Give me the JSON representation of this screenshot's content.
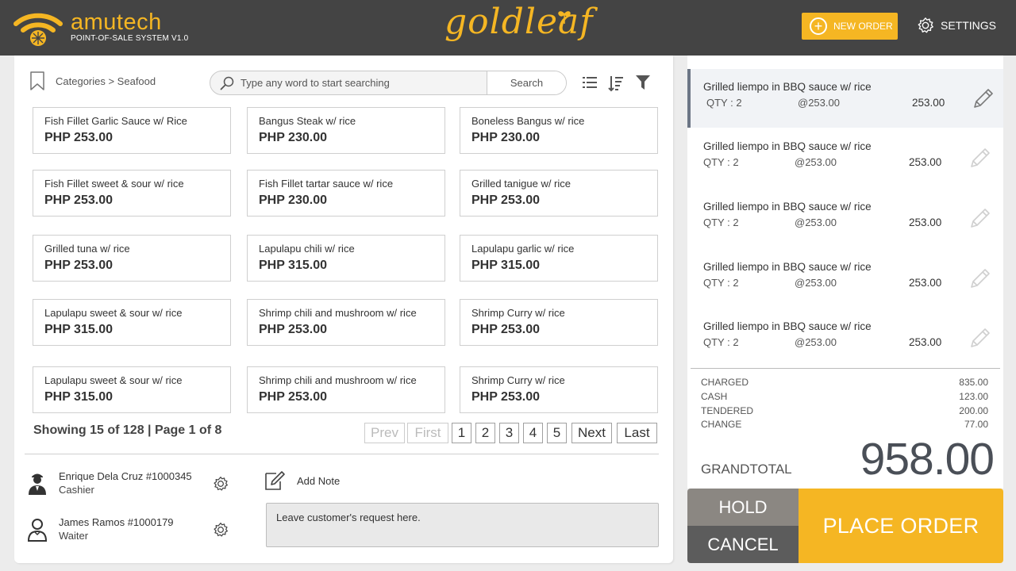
{
  "header": {
    "brand_name": "amutech",
    "brand_sub": "POINT-OF-SALE SYSTEM V1.0",
    "store_name": "goldleaf",
    "new_order_label": "NEW ORDER",
    "settings_label": "SETTINGS",
    "accent_color": "#f5b623",
    "bar_color": "#444444"
  },
  "breadcrumb": {
    "text": "Categories > Seafood",
    "icon": "bookmark-icon"
  },
  "search": {
    "placeholder": "Type any word to start searching",
    "button_label": "Search",
    "icon": "search-icon"
  },
  "toolbar": {
    "icons": [
      "list-view-icon",
      "sort-icon",
      "filter-icon"
    ]
  },
  "products": [
    {
      "name": "Fish Fillet Garlic Sauce w/ Rice",
      "price": "PHP 253.00"
    },
    {
      "name": "Bangus Steak w/ rice",
      "price": "PHP 230.00"
    },
    {
      "name": "Boneless Bangus w/ rice",
      "price": "PHP 230.00"
    },
    {
      "name": "Fish Fillet sweet & sour w/ rice",
      "price": "PHP 253.00"
    },
    {
      "name": "Fish Fillet tartar sauce w/ rice",
      "price": "PHP 230.00"
    },
    {
      "name": "Grilled tanigue w/ rice",
      "price": "PHP 253.00"
    },
    {
      "name": "Grilled tuna w/ rice",
      "price": "PHP 253.00"
    },
    {
      "name": "Lapulapu chili w/ rice",
      "price": "PHP 315.00"
    },
    {
      "name": "Lapulapu garlic w/ rice",
      "price": "PHP 315.00"
    },
    {
      "name": "Lapulapu sweet & sour w/ rice",
      "price": "PHP 315.00"
    },
    {
      "name": "Shrimp chili and mushroom w/ rice",
      "price": "PHP 253.00"
    },
    {
      "name": "Shrimp Curry w/ rice",
      "price": "PHP 253.00"
    },
    {
      "name": "Lapulapu sweet & sour w/ rice",
      "price": "PHP 315.00"
    },
    {
      "name": "Shrimp chili and mushroom w/ rice",
      "price": "PHP 253.00"
    },
    {
      "name": "Shrimp Curry w/ rice",
      "price": "PHP 253.00"
    }
  ],
  "pagination": {
    "showing_text": "Showing 15 of 128 | Page 1 of 8",
    "prev": "Prev",
    "first": "First",
    "pages": [
      "1",
      "2",
      "3",
      "4",
      "5"
    ],
    "next": "Next",
    "last": "Last"
  },
  "staff": [
    {
      "name": "Enrique Dela Cruz  #1000345",
      "role": "Cashier"
    },
    {
      "name": "James Ramos  #1000179",
      "role": "Waiter"
    }
  ],
  "note": {
    "label": "Add Note",
    "placeholder": "Leave customer's request here."
  },
  "order_items": [
    {
      "name": "Grilled liempo in BBQ sauce w/ rice",
      "qty": "QTY : 2",
      "unit_price": "@253.00",
      "total": "253.00",
      "selected": true
    },
    {
      "name": "Grilled liempo in BBQ sauce w/ rice",
      "qty": "QTY : 2",
      "unit_price": "@253.00",
      "total": "253.00",
      "selected": false
    },
    {
      "name": "Grilled liempo in BBQ sauce w/ rice",
      "qty": "QTY : 2",
      "unit_price": "@253.00",
      "total": "253.00",
      "selected": false
    },
    {
      "name": "Grilled liempo in BBQ sauce w/ rice",
      "qty": "QTY : 2",
      "unit_price": "@253.00",
      "total": "253.00",
      "selected": false
    },
    {
      "name": "Grilled liempo in BBQ sauce w/ rice",
      "qty": "QTY : 2",
      "unit_price": "@253.00",
      "total": "253.00",
      "selected": false
    }
  ],
  "summary": [
    {
      "label": "CHARGED",
      "value": "835.00"
    },
    {
      "label": "CASH",
      "value": "123.00"
    },
    {
      "label": "TENDERED",
      "value": "200.00"
    },
    {
      "label": "CHANGE",
      "value": "77.00"
    }
  ],
  "grand_total": {
    "label": "GRANDTOTAL",
    "value": "958.00"
  },
  "actions": {
    "hold": "HOLD",
    "cancel": "CANCEL",
    "place_order": "PLACE ORDER"
  }
}
